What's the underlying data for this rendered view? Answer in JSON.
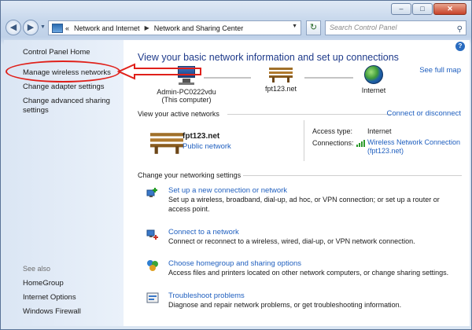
{
  "window": {
    "caption_buttons": [
      "–",
      "□",
      "✕"
    ]
  },
  "address_bar": {
    "back_icon": "back-arrow-icon",
    "forward_icon": "forward-arrow-icon",
    "overflow": "«",
    "crumbs": [
      "Network and Internet",
      "Network and Sharing Center"
    ],
    "search_placeholder": "Search Control Panel"
  },
  "left_pane": {
    "links": [
      "Control Panel Home",
      "Manage wireless networks",
      "Change adapter settings",
      "Change advanced sharing settings"
    ],
    "see_also_label": "See also",
    "see_also": [
      "HomeGroup",
      "Internet Options",
      "Windows Firewall"
    ]
  },
  "main": {
    "title": "View your basic network information and set up connections",
    "see_full_map": "See full map",
    "map": {
      "computer_name": "Admin-PC0222vdu",
      "computer_note": "(This computer)",
      "network": "fpt123.net",
      "internet": "Internet"
    },
    "active_networks_label": "View your active networks",
    "connect_disconnect": "Connect or disconnect",
    "active_network": {
      "name": "fpt123.net",
      "category": "Public network",
      "access_type_label": "Access type:",
      "access_type_value": "Internet",
      "connections_label": "Connections:",
      "connection_name": "Wireless Network Connection",
      "connection_ssid": "(fpt123.net)"
    },
    "change_settings_label": "Change your networking settings",
    "tasks": [
      {
        "title": "Set up a new connection or network",
        "desc": "Set up a wireless, broadband, dial-up, ad hoc, or VPN connection; or set up a router or access point.",
        "icon": "new-connection-icon"
      },
      {
        "title": "Connect to a network",
        "desc": "Connect or reconnect to a wireless, wired, dial-up, or VPN network connection.",
        "icon": "connect-network-icon"
      },
      {
        "title": "Choose homegroup and sharing options",
        "desc": "Access files and printers located on other network computers, or change sharing settings.",
        "icon": "homegroup-icon"
      },
      {
        "title": "Troubleshoot problems",
        "desc": "Diagnose and repair network problems, or get troubleshooting information.",
        "icon": "troubleshoot-icon"
      }
    ]
  },
  "colors": {
    "link": "#1f5fbf",
    "title": "#1e3a8a",
    "annotation": "#e0201a"
  }
}
